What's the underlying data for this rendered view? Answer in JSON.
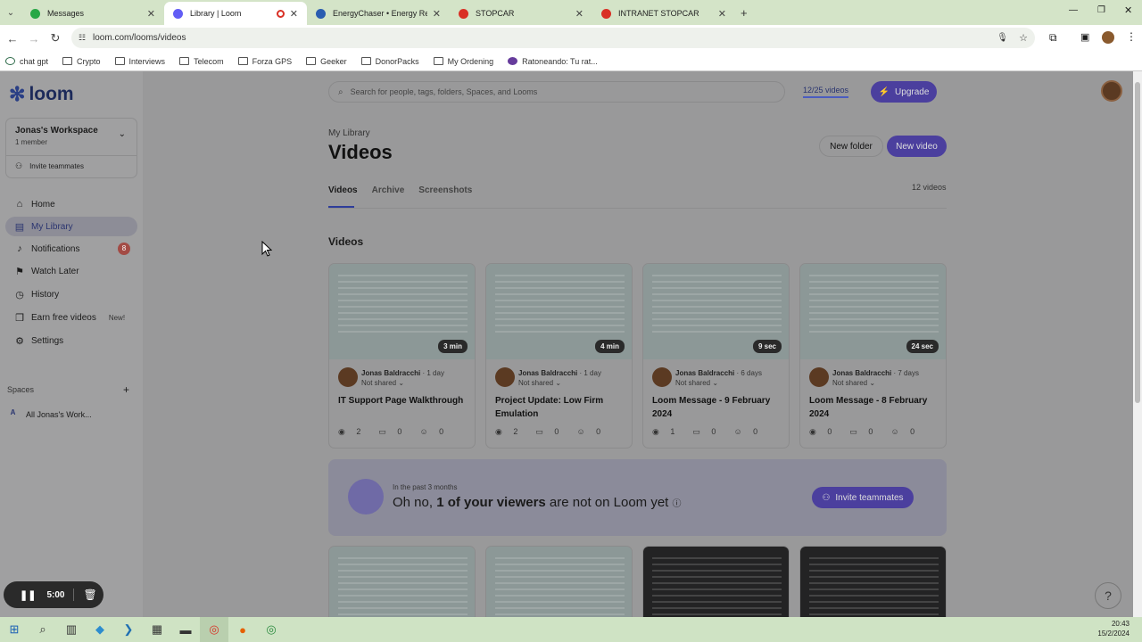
{
  "browser": {
    "tabs": [
      {
        "title": "Messages",
        "color": "#27a745"
      },
      {
        "title": "Library | Loom",
        "color": "#625df5"
      },
      {
        "title": "EnergyChaser • Energy Reporti...",
        "color": "#2a5db0"
      },
      {
        "title": "STOPCAR",
        "color": "#d93025"
      },
      {
        "title": "INTRANET STOPCAR",
        "color": "#d93025"
      }
    ],
    "url": "loom.com/looms/videos",
    "bookmarks": [
      "chat gpt",
      "Crypto",
      "Interviews",
      "Telecom",
      "Forza GPS",
      "Geeker",
      "DonorPacks",
      "My Ordening",
      "Ratoneando: Tu rat..."
    ]
  },
  "sidebar": {
    "brand": "loom",
    "workspace": {
      "name": "Jonas's Workspace",
      "members": "1 member",
      "invite": "Invite teammates"
    },
    "items": [
      {
        "label": "Home",
        "icon": "home-icon",
        "glyph": "⌂"
      },
      {
        "label": "My Library",
        "icon": "library-icon",
        "glyph": "▤"
      },
      {
        "label": "Notifications",
        "icon": "bell-icon",
        "glyph": "♫",
        "badge": "8"
      },
      {
        "label": "Watch Later",
        "icon": "bookmark-icon",
        "glyph": "⚑"
      },
      {
        "label": "History",
        "icon": "clock-icon",
        "glyph": "◷"
      },
      {
        "label": "Earn free videos",
        "icon": "gift-icon",
        "glyph": "❒",
        "tag": "New!"
      },
      {
        "label": "Settings",
        "icon": "gear-icon",
        "glyph": "⚙"
      }
    ],
    "spaces_heading": "Spaces",
    "space_item": {
      "initial": "A",
      "label": "All Jonas's Work..."
    },
    "recorder_time": "5:00"
  },
  "header": {
    "search_placeholder": "Search for people, tags, folders, Spaces, and Looms",
    "quota": "12/25 videos",
    "upgrade": "Upgrade"
  },
  "main": {
    "breadcrumb": "My Library",
    "title": "Videos",
    "new_folder": "New folder",
    "new_video": "New video",
    "tabs": [
      "Videos",
      "Archive",
      "Screenshots"
    ],
    "count": "12 videos",
    "section": "Videos",
    "videos": [
      {
        "duration": "3 min",
        "author": "Jonas Baldracchi",
        "ago": "· 1 day",
        "sharing": "Not shared",
        "title": "IT Support Page Walkthrough",
        "views": "2",
        "comments": "0",
        "reactions": "0"
      },
      {
        "duration": "4 min",
        "author": "Jonas Baldracchi",
        "ago": "· 1 day",
        "sharing": "Not shared",
        "title": "Project Update: Low Firm Emulation",
        "views": "2",
        "comments": "0",
        "reactions": "0"
      },
      {
        "duration": "9 sec",
        "author": "Jonas Baldracchi",
        "ago": "· 6 days",
        "sharing": "Not shared",
        "title": "Loom Message - 9 February 2024",
        "views": "1",
        "comments": "0",
        "reactions": "0"
      },
      {
        "duration": "24 sec",
        "author": "Jonas Baldracchi",
        "ago": "· 7 days",
        "sharing": "Not shared",
        "title": "Loom Message - 8 February 2024",
        "views": "0",
        "comments": "0",
        "reactions": "0"
      }
    ],
    "promo": {
      "subtitle": "In the past 3 months",
      "pre": "Oh no, ",
      "bold": "1 of your viewers",
      "post": " are not on Loom yet",
      "button": "Invite teammates"
    }
  },
  "taskbar": {
    "time": "20:43",
    "date": "15/2/2024"
  }
}
